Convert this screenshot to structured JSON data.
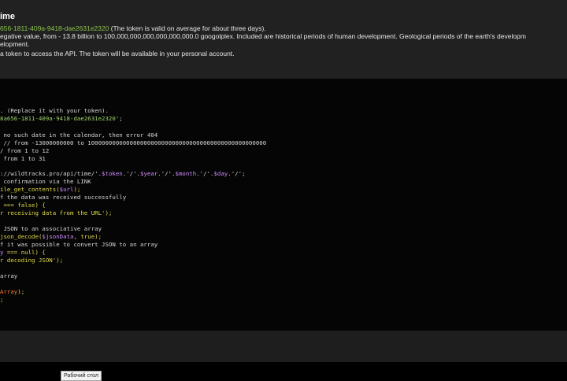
{
  "header": {
    "title": "ime",
    "token": "656-1811-409a-9418-dae2631e2320",
    "token_note": " (The token is valid on average for about three days).",
    "line2": "egative value, from - 13.8 billion to 100,000,000,000,000,000,000.0 googolplex. Included are historical periods of human development. Geological periods of the earth's developm",
    "line3": "elopment.",
    "line4": "a token to access the API. The token will be available in your personal account."
  },
  "code": {
    "l01": ". (Replace it with your token).",
    "l02a": "8a656-1811-409a-9418-dae2631e2320",
    "l02b": "';",
    "l03": " no such date in the calendar, then error 404",
    "l04": " // from -13000000000 to 100000000000000000000000000000000000000000000000000",
    "l05": "/ from 1 to 12",
    "l06": " from 1 to 31",
    "l07a": "://wildtracks.pro/api/time/'.",
    "l07b": "$token",
    "l07c": ".'/'.",
    "l07d": "$year",
    "l07e": ".'/'.",
    "l07f": "$month",
    "l07g": ".'/'.",
    "l07h": "$day",
    "l07i": ".'/';",
    "l08": " confirmation via the LINK",
    "l09a": "ile_get_contents(",
    "l09b": "$url",
    "l09c": ");",
    "l10": "f the data was received successfully",
    "l11a": " === false) {",
    "l12": "r receiving data from the URL');",
    "l13": " JSON to an associative array",
    "l14a": "json_decode(",
    "l14b": "$jsonData",
    "l14c": ", true);",
    "l15": "f it was possible to convert JSON to an array",
    "l16a": "y",
    "l16b": " === null) {",
    "l17": "r decoding JSON');",
    "l18": "array",
    "l19a": "Array",
    "l19b": ");",
    "l20": ";"
  },
  "taskbar": {
    "tooltip": "Рабочий стол"
  }
}
